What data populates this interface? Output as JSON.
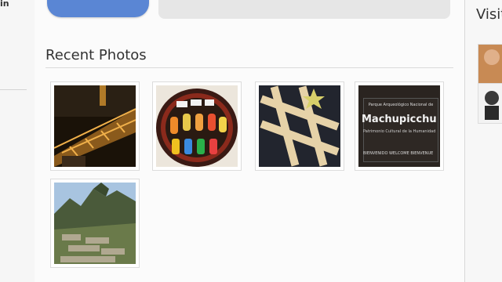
{
  "left_sidebar": {
    "top_label": "in"
  },
  "main": {
    "section_title": "Recent Photos",
    "photos": [
      {
        "label": "Sydney Harbour Bridge photo"
      },
      {
        "label": "Sushi tray photo"
      },
      {
        "label": "Wooden pattern photo"
      },
      {
        "label": "Machupicchu sign photo"
      },
      {
        "label": "Machu Picchu ruins photo"
      }
    ],
    "sign_text": {
      "small_top": "Parque Arqueológico Nacional de",
      "big": "Machupicchu",
      "sub": "Patrimonio Cultural de la Humanidad",
      "welcome": "BIENVENIDO   WELCOME   BIENVENUE"
    }
  },
  "right_col": {
    "title": "Visit"
  },
  "colors": {
    "accent": "#5a86d4",
    "panel_gray": "#e6e6e6",
    "title": "#333333"
  }
}
